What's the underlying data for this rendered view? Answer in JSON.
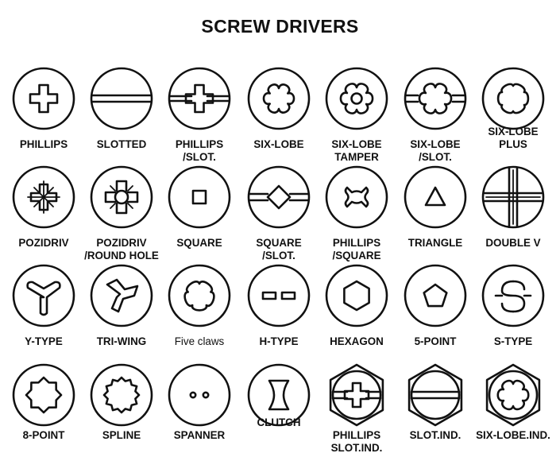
{
  "title": "SCREW DRIVERS",
  "drives": [
    {
      "label": "PHILLIPS",
      "icon": "phillips-icon"
    },
    {
      "label": "SLOTTED",
      "icon": "slotted-icon"
    },
    {
      "label": "PHILLIPS\n/SLOT.",
      "icon": "phillips-slot-icon"
    },
    {
      "label": "SIX-LOBE",
      "icon": "six-lobe-icon"
    },
    {
      "label": "SIX-LOBE\nTAMPER",
      "icon": "six-lobe-tamper-icon"
    },
    {
      "label": "SIX-LOBE\n/SLOT.",
      "icon": "six-lobe-slot-icon"
    },
    {
      "label": "SIX-LOBE\nPLUS",
      "icon": "six-lobe-plus-icon"
    },
    {
      "label": "POZIDRIV",
      "icon": "pozidriv-icon"
    },
    {
      "label": "POZIDRIV\n/ROUND HOLE",
      "icon": "pozidriv-round-hole-icon"
    },
    {
      "label": "SQUARE",
      "icon": "square-icon"
    },
    {
      "label": "SQUARE\n/SLOT.",
      "icon": "square-slot-icon"
    },
    {
      "label": "PHILLIPS\n/SQUARE",
      "icon": "phillips-square-icon"
    },
    {
      "label": "TRIANGLE",
      "icon": "triangle-icon"
    },
    {
      "label": "DOUBLE V",
      "icon": "double-v-icon"
    },
    {
      "label": "Y-TYPE",
      "icon": "y-type-icon"
    },
    {
      "label": "TRI-WING",
      "icon": "tri-wing-icon"
    },
    {
      "label": "Five claws",
      "icon": "five-claws-icon"
    },
    {
      "label": "H-TYPE",
      "icon": "h-type-icon"
    },
    {
      "label": "HEXAGON",
      "icon": "hexagon-icon"
    },
    {
      "label": "5-POINT",
      "icon": "five-point-icon"
    },
    {
      "label": "S-TYPE",
      "icon": "s-type-icon"
    },
    {
      "label": "8-POINT",
      "icon": "eight-point-icon"
    },
    {
      "label": "SPLINE",
      "icon": "spline-icon"
    },
    {
      "label": "SPANNER",
      "icon": "spanner-icon"
    },
    {
      "label": "CLUTCH",
      "icon": "clutch-icon"
    },
    {
      "label": "PHILLIPS\nSLOT.IND.",
      "icon": "phillips-slot-ind-icon"
    },
    {
      "label": "SLOT.IND.",
      "icon": "slot-ind-icon"
    },
    {
      "label": "SIX-LOBE.IND.",
      "icon": "six-lobe-ind-icon"
    }
  ]
}
